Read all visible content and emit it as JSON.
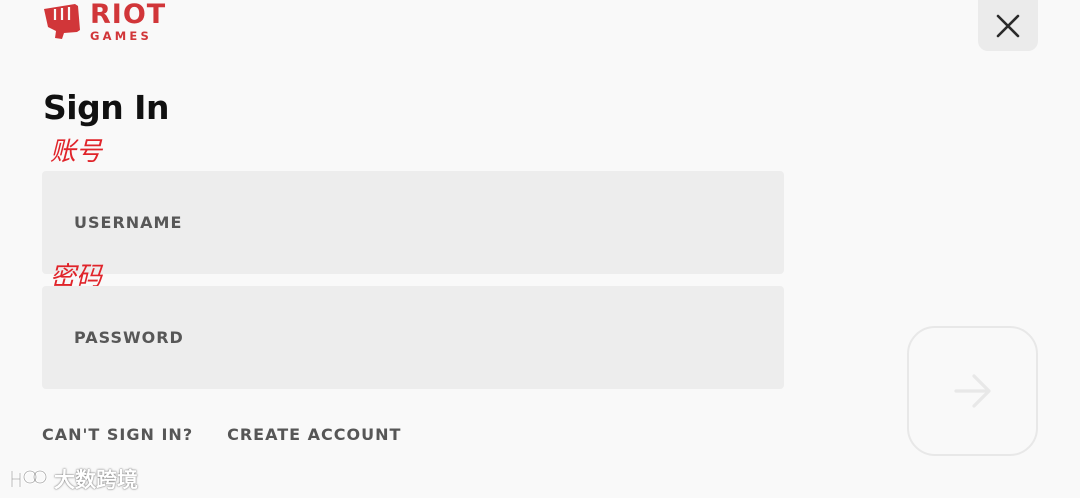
{
  "brand": {
    "name_top": "RIOT",
    "name_bottom": "GAMES",
    "color": "#d13639",
    "logo_icon": "riot-fist-icon"
  },
  "header": {
    "close_icon": "close-icon"
  },
  "title": "Sign In",
  "annotations": {
    "account": "账号",
    "password": "密码",
    "color": "#e0242a"
  },
  "form": {
    "username": {
      "placeholder": "USERNAME",
      "value": ""
    },
    "password": {
      "placeholder": "PASSWORD",
      "value": ""
    }
  },
  "links": {
    "cant_sign_in": "CAN'T SIGN IN?",
    "create_account": "CREATE ACCOUNT"
  },
  "submit": {
    "icon": "arrow-right-icon",
    "disabled": true
  },
  "watermark": {
    "text": "大数跨境"
  },
  "colors": {
    "background": "#f9f9f9",
    "field_background": "#ededed",
    "text_dark": "#111111",
    "text_muted": "#565656"
  }
}
